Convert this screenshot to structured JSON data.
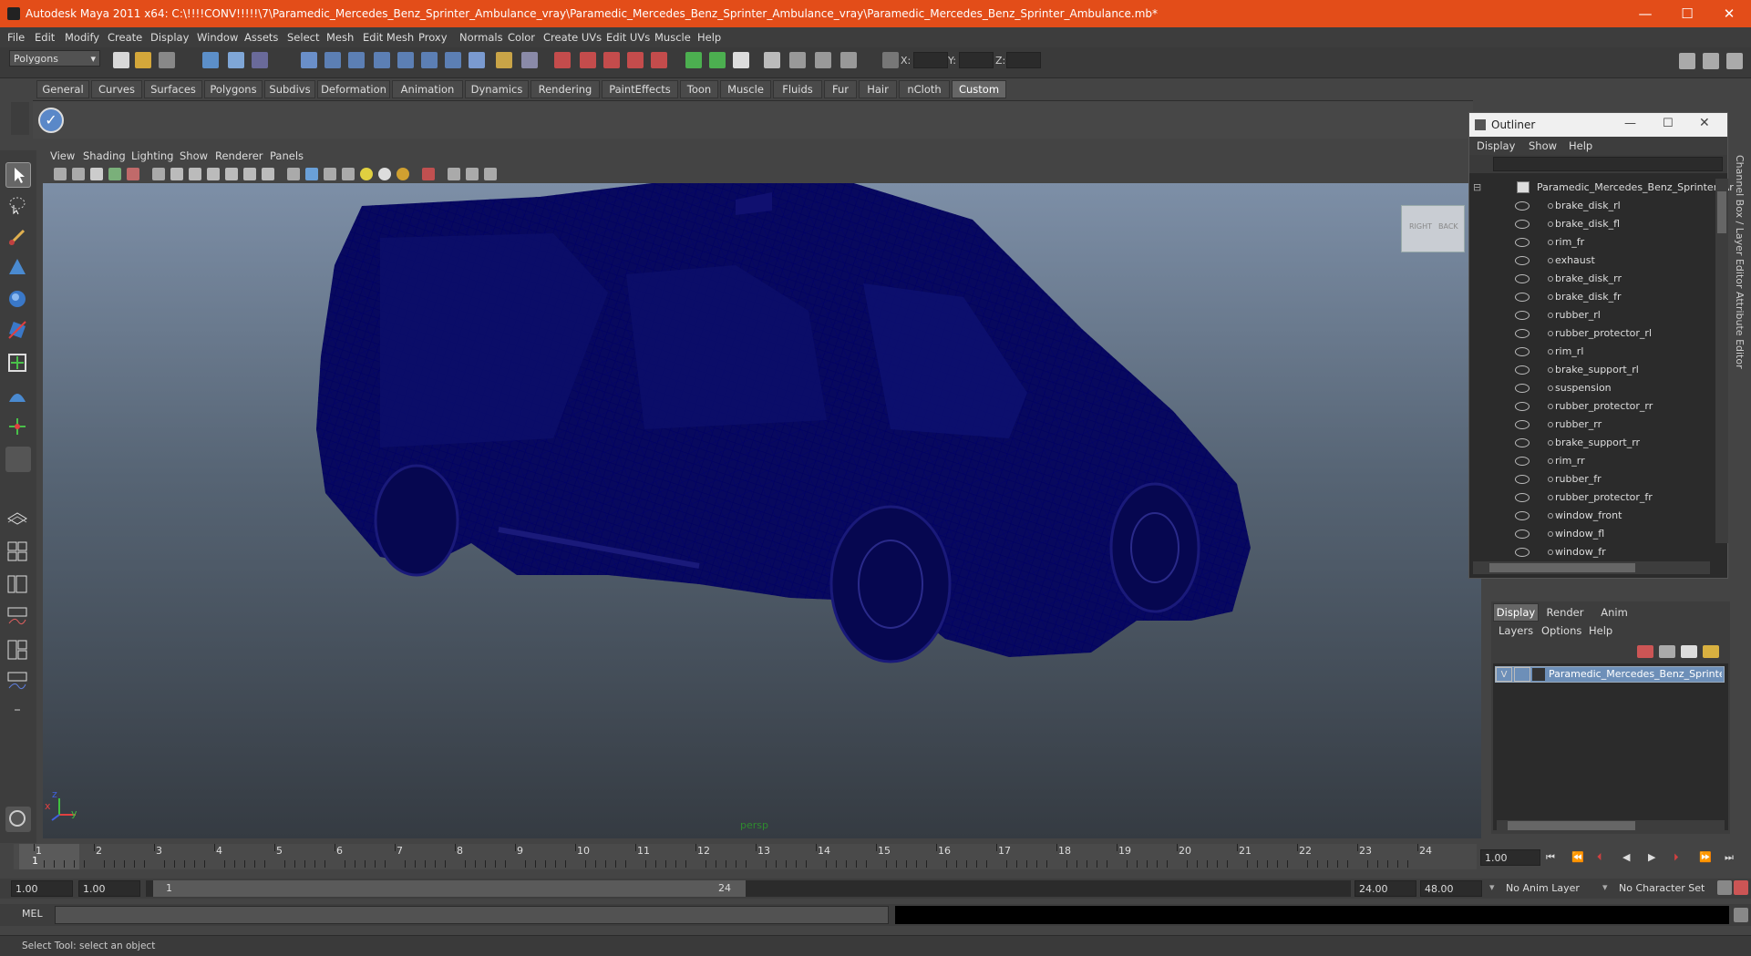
{
  "window": {
    "title": "Autodesk Maya 2011 x64: C:\\!!!!CONV!!!!!\\7\\Paramedic_Mercedes_Benz_Sprinter_Ambulance_vray\\Paramedic_Mercedes_Benz_Sprinter_Ambulance_vray\\Paramedic_Mercedes_Benz_Sprinter_Ambulance.mb*",
    "minimize": "—",
    "maximize": "☐",
    "close": "✕"
  },
  "menubar": [
    "File",
    "Edit",
    "Modify",
    "Create",
    "Display",
    "Window",
    "Assets",
    "Select",
    "Mesh",
    "Edit Mesh",
    "Proxy",
    "Normals",
    "Color",
    "Create UVs",
    "Edit UVs",
    "Muscle",
    "Help"
  ],
  "statusline": {
    "mode": "Polygons",
    "x_label": "X:",
    "y_label": "Y:",
    "z_label": "Z:"
  },
  "shelf_tabs": [
    "General",
    "Curves",
    "Surfaces",
    "Polygons",
    "Subdivs",
    "Deformation",
    "Animation",
    "Dynamics",
    "Rendering",
    "PaintEffects",
    "Toon",
    "Muscle",
    "Fluids",
    "Fur",
    "Hair",
    "nCloth",
    "Custom"
  ],
  "viewport": {
    "menus": [
      "View",
      "Shading",
      "Lighting",
      "Show",
      "Renderer",
      "Panels"
    ],
    "camera": "persp",
    "viewcube_right": "RIGHT",
    "viewcube_back": "BACK",
    "axis_x": "x",
    "axis_y": "y",
    "axis_z": "z"
  },
  "outliner": {
    "title": "Outliner",
    "menus": [
      "Display",
      "Show",
      "Help"
    ],
    "root": "Paramedic_Mercedes_Benz_Sprinter_Ar",
    "items": [
      "brake_disk_rl",
      "brake_disk_fl",
      "rim_fr",
      "exhaust",
      "brake_disk_rr",
      "brake_disk_fr",
      "rubber_rl",
      "rubber_protector_rl",
      "rim_rl",
      "brake_support_rl",
      "suspension",
      "rubber_protector_rr",
      "rubber_rr",
      "brake_support_rr",
      "rim_rr",
      "rubber_fr",
      "rubber_protector_fr",
      "window_front",
      "window_fl",
      "window_fr"
    ]
  },
  "side_tabs": [
    "Channel Box / Layer Editor",
    "Attribute Editor"
  ],
  "layers": {
    "tabs": [
      "Display",
      "Render",
      "Anim"
    ],
    "menus": [
      "Layers",
      "Options",
      "Help"
    ],
    "layer_v": "V",
    "layer_name": "Paramedic_Mercedes_Benz_Sprinter_"
  },
  "timeline": {
    "ticks": [
      "1",
      "2",
      "3",
      "4",
      "5",
      "6",
      "7",
      "8",
      "9",
      "10",
      "11",
      "12",
      "13",
      "14",
      "15",
      "16",
      "17",
      "18",
      "19",
      "20",
      "21",
      "22",
      "23",
      "24"
    ],
    "current_frame": "1",
    "current_field": "1.00"
  },
  "range": {
    "start": "1.00",
    "playback_start": "1.00",
    "slider_start": "1",
    "slider_end": "24",
    "playback_end": "24.00",
    "end": "48.00",
    "anim_layer": "No Anim Layer",
    "character_set": "No Character Set"
  },
  "mel": {
    "label": "MEL"
  },
  "help": {
    "text": "Select Tool: select an object"
  }
}
